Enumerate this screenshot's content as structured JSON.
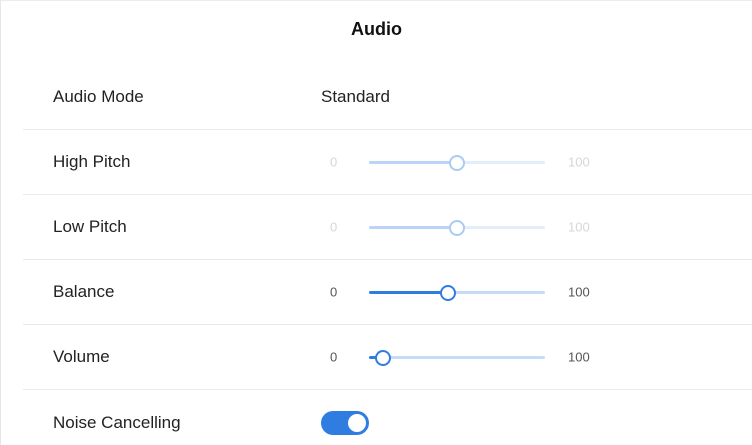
{
  "header": {
    "title": "Audio"
  },
  "audio_mode": {
    "label": "Audio Mode",
    "value": "Standard"
  },
  "sliders": [
    {
      "key": "high_pitch",
      "label": "High Pitch",
      "min_label": "0",
      "max_label": "100",
      "value": 50,
      "enabled": false
    },
    {
      "key": "low_pitch",
      "label": "Low Pitch",
      "min_label": "0",
      "max_label": "100",
      "value": 50,
      "enabled": false
    },
    {
      "key": "balance",
      "label": "Balance",
      "min_label": "0",
      "max_label": "100",
      "value": 45,
      "enabled": true
    },
    {
      "key": "volume",
      "label": "Volume",
      "min_label": "0",
      "max_label": "100",
      "value": 8,
      "enabled": true
    }
  ],
  "noise_cancelling": {
    "label": "Noise Cancelling",
    "on": true
  },
  "colors": {
    "accent": "#2f7de1",
    "track": "#c6dbf6",
    "divider": "#e9e9e9",
    "disabled_text": "#d6d6d6"
  },
  "icons": {
    "chevron": "chevron-right-icon"
  }
}
